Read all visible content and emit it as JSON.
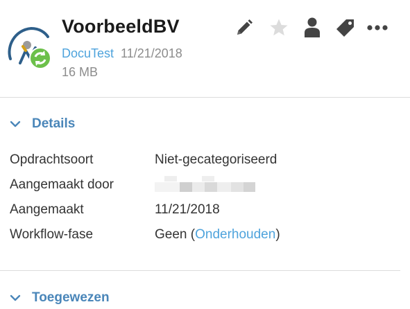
{
  "header": {
    "title": "VoorbeeldBV",
    "source_link": "DocuTest",
    "date": "11/21/2018",
    "size": "16 MB",
    "logo": "docutest-logo-sync-badge"
  },
  "toolbar": {
    "icons": [
      "pencil-icon",
      "star-icon",
      "person-icon",
      "tag-icon",
      "more-icon"
    ],
    "icon_color": "#444444",
    "star_color": "#dcdcdc"
  },
  "details": {
    "title": "Details",
    "rows": [
      {
        "key": "Opdrachtsoort",
        "value": "Niet-gecategoriseerd"
      },
      {
        "key": "Aangemaakt door",
        "value": ""
      },
      {
        "key": "Aangemaakt",
        "value": "11/21/2018"
      },
      {
        "key": "Workflow-fase",
        "value_prefix": "Geen (",
        "value_link": "Onderhouden",
        "value_suffix": ")"
      }
    ]
  },
  "assigned": {
    "title": "Toegewezen"
  },
  "colors": {
    "accent": "#4a86b9",
    "link": "#4ea3dc",
    "muted": "#8c8c8c",
    "badge_green": "#6cc04a"
  }
}
